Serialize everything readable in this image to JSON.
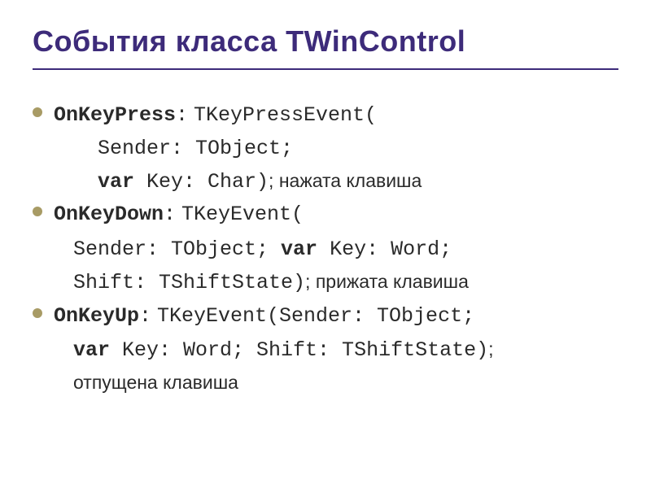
{
  "slide": {
    "heading": "События класса TWinControl",
    "items": [
      {
        "event_name": "OnKeyPress",
        "type": "TKeyPressEvent(",
        "lines": [
          "Sender: TObject;",
          {
            "prefix": "var",
            "rest": " Key: Char)",
            "note": "; нажата клавиша"
          }
        ]
      },
      {
        "event_name": "OnKeyDown",
        "type": "TKeyEvent(",
        "lines": [
          {
            "plain": "Sender: TObject; ",
            "bold": "var",
            "rest": " Key: Word;"
          },
          {
            "plain": "Shift: TShiftState)",
            "note": "; прижата клавиша"
          }
        ]
      },
      {
        "event_name": "OnKeyUp",
        "type": "TKeyEvent(",
        "type_rest": "Sender: TObject;",
        "lines": [
          {
            "bold": "var",
            "rest": " Key: Word; Shift: TShiftState)",
            "note": ";"
          },
          {
            "note_only": "отпущена клавиша"
          }
        ]
      }
    ]
  }
}
